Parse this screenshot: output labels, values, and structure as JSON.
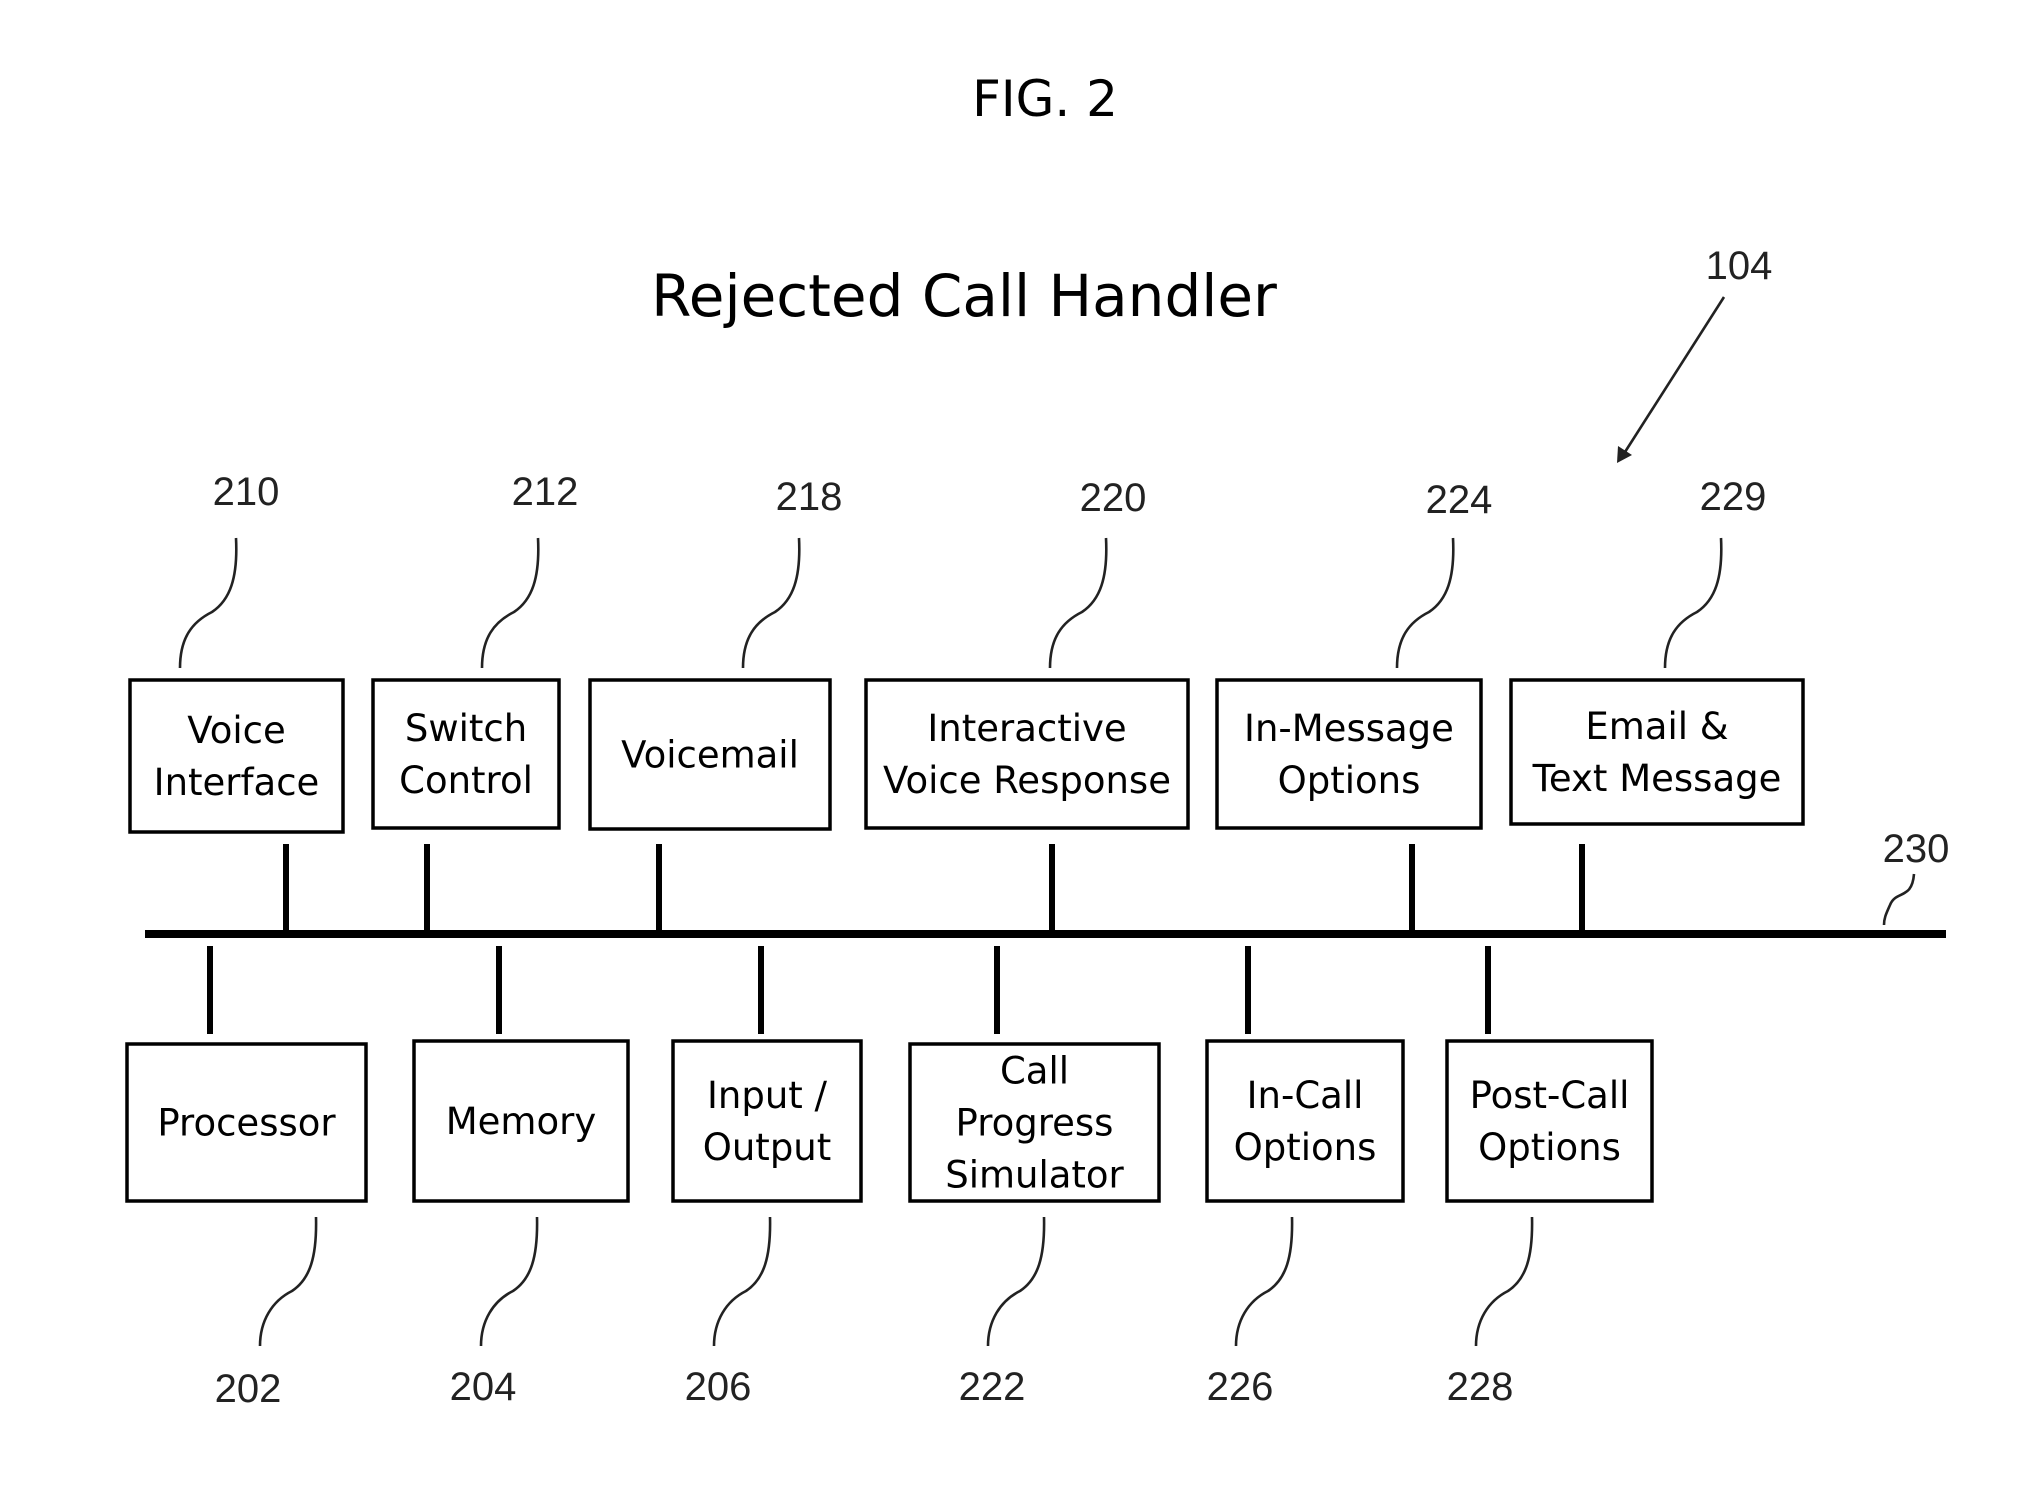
{
  "figure_label": "FIG. 2",
  "title": "Rejected Call Handler",
  "system_ref": "104",
  "bus": {
    "ref": "230"
  },
  "top_components": [
    {
      "id": "voice-interface",
      "lines": [
        "Voice",
        "Interface"
      ],
      "ref": "210"
    },
    {
      "id": "switch-control",
      "lines": [
        "Switch",
        "Control"
      ],
      "ref": "212"
    },
    {
      "id": "voicemail",
      "lines": [
        "Voicemail"
      ],
      "ref": "218"
    },
    {
      "id": "interactive-voice-response",
      "lines": [
        "Interactive",
        "Voice Response"
      ],
      "ref": "220"
    },
    {
      "id": "in-message-options",
      "lines": [
        "In-Message",
        "Options"
      ],
      "ref": "224"
    },
    {
      "id": "email-text-message",
      "lines": [
        "Email &",
        "Text Message"
      ],
      "ref": "229"
    }
  ],
  "bottom_components": [
    {
      "id": "processor",
      "lines": [
        "Processor"
      ],
      "ref": "202"
    },
    {
      "id": "memory",
      "lines": [
        "Memory"
      ],
      "ref": "204"
    },
    {
      "id": "input-output",
      "lines": [
        "Input /",
        "Output"
      ],
      "ref": "206"
    },
    {
      "id": "call-progress-simulator",
      "lines": [
        "Call",
        "Progress",
        "Simulator"
      ],
      "ref": "222"
    },
    {
      "id": "in-call-options",
      "lines": [
        "In-Call",
        "Options"
      ],
      "ref": "226"
    },
    {
      "id": "post-call-options",
      "lines": [
        "Post-Call",
        "Options"
      ],
      "ref": "228"
    }
  ]
}
